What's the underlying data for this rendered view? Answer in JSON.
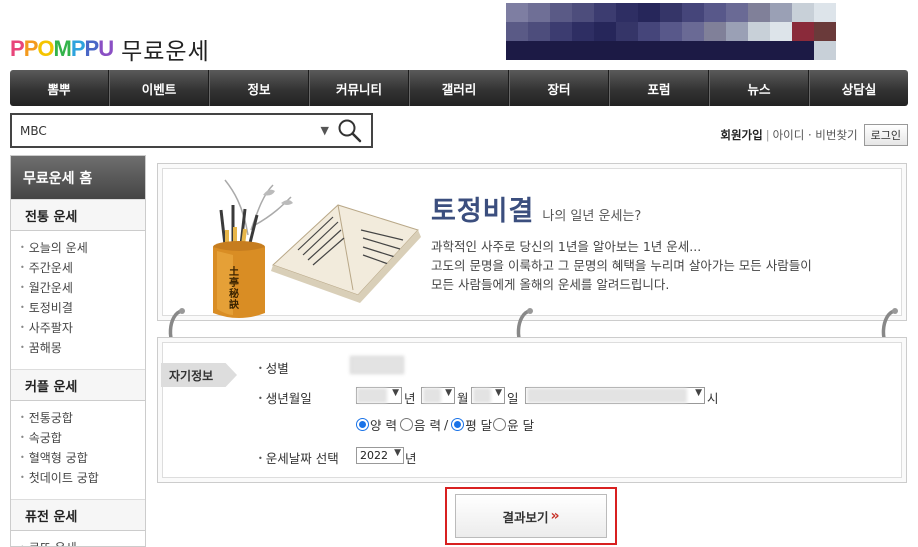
{
  "logo": {
    "letters": [
      "P",
      "P",
      "O",
      "M",
      "P",
      "P",
      "U"
    ],
    "letter_colors": [
      "#e8457a",
      "#f39a1e",
      "#f5c400",
      "#33b34a",
      "#2ea3dd",
      "#4a67c6",
      "#8a4fc4"
    ],
    "section": "무료운세"
  },
  "nav": {
    "items": [
      "뽐뿌",
      "이벤트",
      "정보",
      "커뮤니티",
      "갤러리",
      "장터",
      "포럼",
      "뉴스",
      "상담실"
    ]
  },
  "search": {
    "value": "MBC"
  },
  "member": {
    "join": "회원가입",
    "find": "아이디 · 비번찾기",
    "login": "로그인"
  },
  "sidebar": {
    "home": "무료운세 홈",
    "sections": [
      {
        "title": "전통 운세",
        "items": [
          "오늘의 운세",
          "주간운세",
          "월간운세",
          "토정비결",
          "사주팔자",
          "꿈해몽"
        ]
      },
      {
        "title": "커플 운세",
        "items": [
          "전통궁합",
          "속궁합",
          "혈액형 궁합",
          "첫데이트 궁합"
        ]
      },
      {
        "title": "퓨전 운세",
        "items": [
          "로또 운세"
        ]
      }
    ]
  },
  "hero": {
    "title": "토정비결",
    "subtitle": "나의 일년 운세는?",
    "desc": [
      "과학적인 사주로 당신의 1년을 알아보는 1년 운세...",
      "고도의 문명을 이룩하고 그 문명의 혜택을 누리며 살아가는 모든 사람들이",
      "모든 사람들에게 올해의 운세를 알려드립니다."
    ],
    "jar_text": "土亭秘訣"
  },
  "form": {
    "tag": "자기정보",
    "gender_label": "성별",
    "birth_label": "생년월일",
    "year_unit": "년",
    "month_unit": "월",
    "day_unit": "일",
    "hour_unit": "시",
    "calendar": {
      "solar": "양 력",
      "lunar": "음 력",
      "slash": "/",
      "normal": "평 달",
      "leap": "윤 달",
      "solar_checked": true,
      "normal_checked": true
    },
    "fortune_year_label": "운세날짜 선택",
    "fortune_year": "2022",
    "fortune_year_unit": "년"
  },
  "result": {
    "label": "결과보기",
    "arrow": "»"
  }
}
